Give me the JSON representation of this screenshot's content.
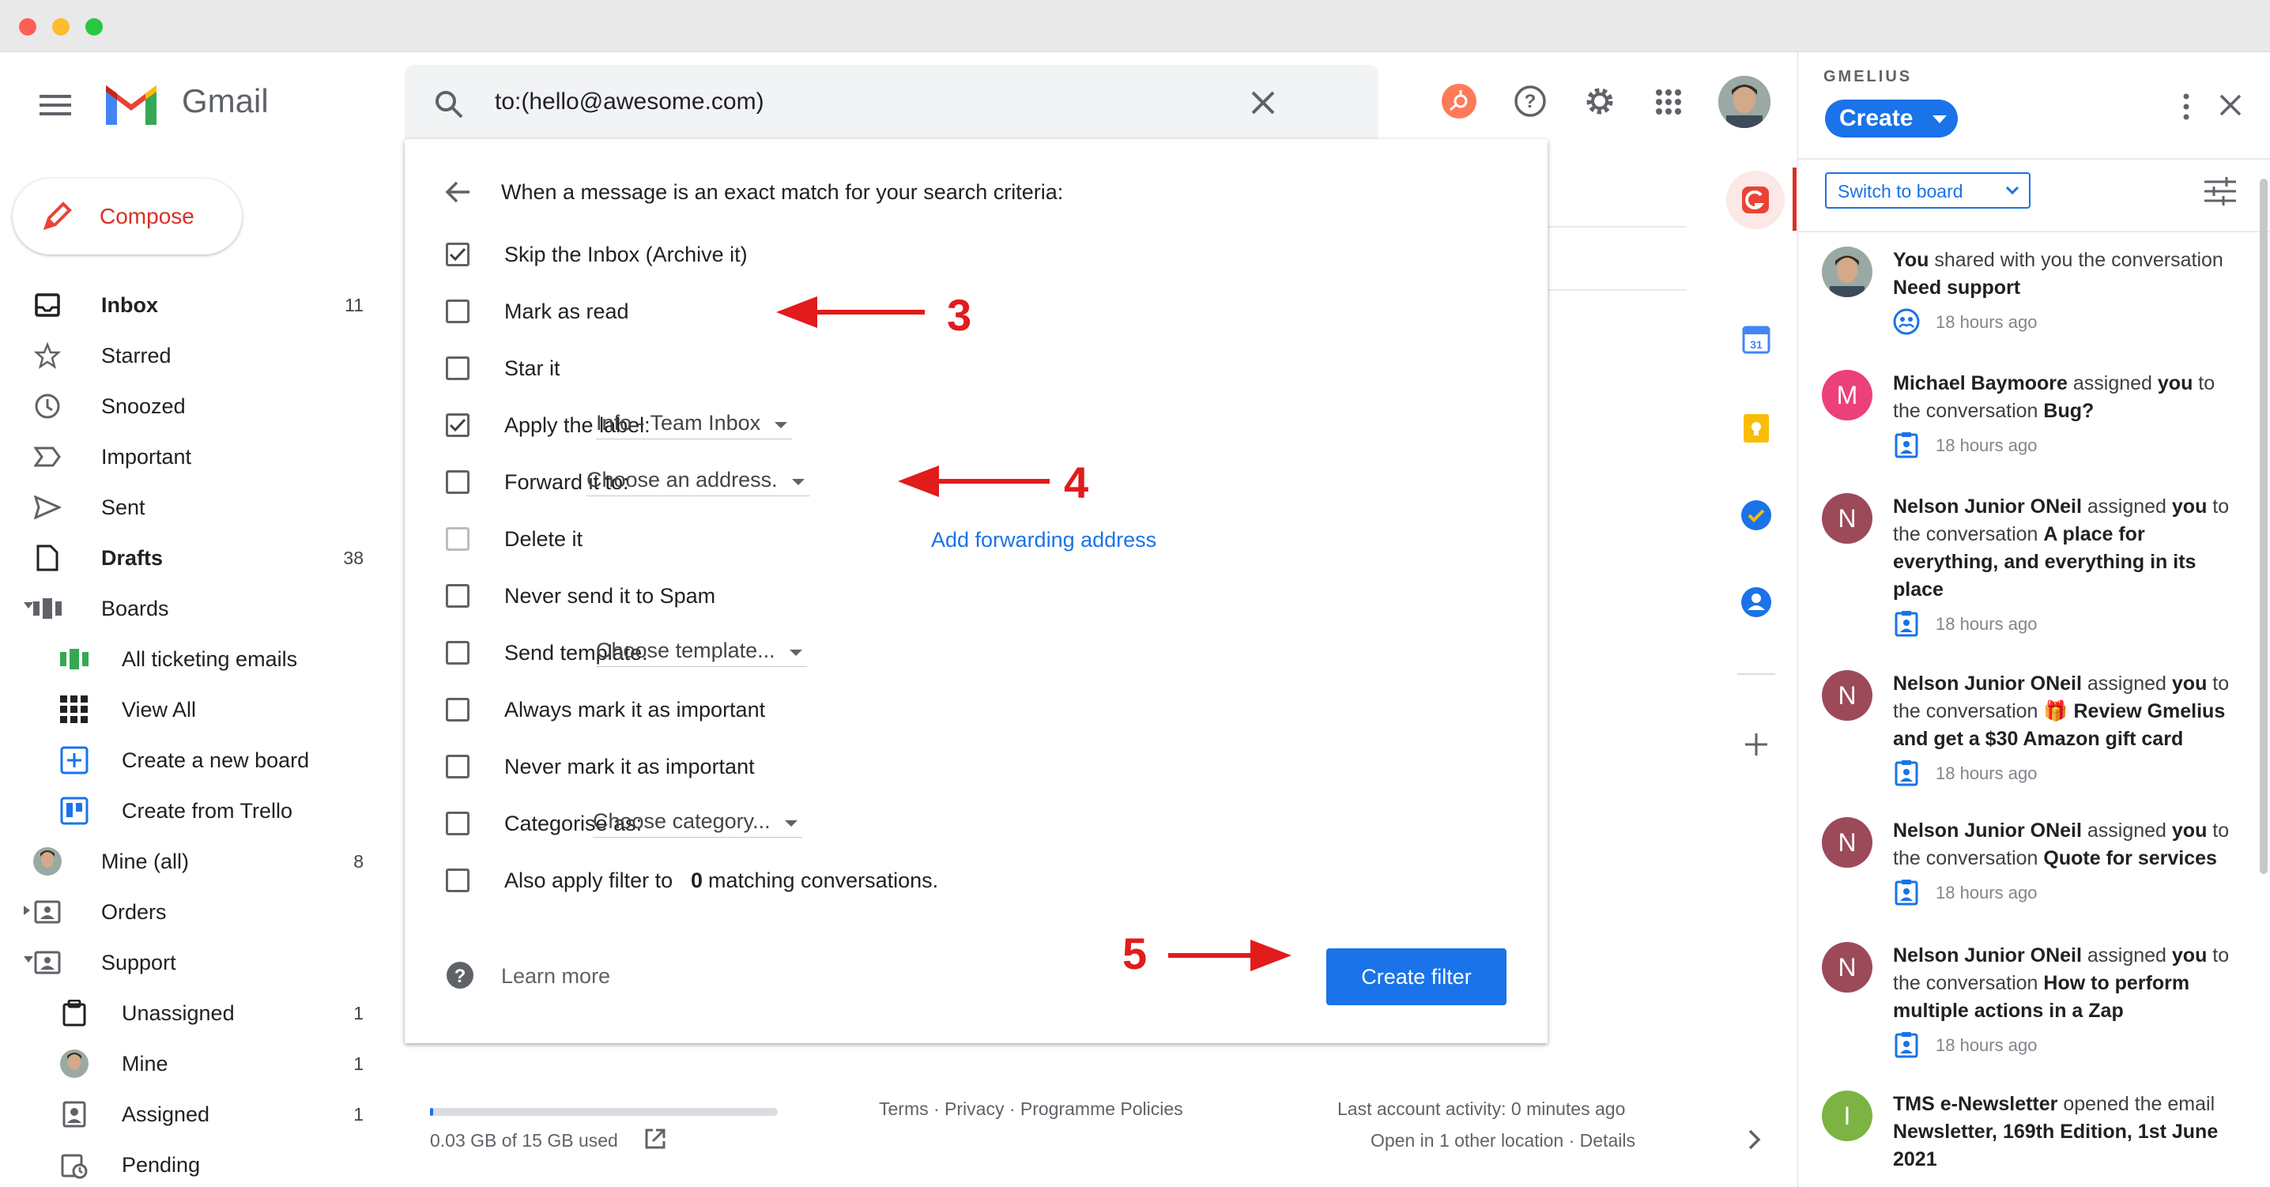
{
  "app": {
    "name": "Gmail",
    "compose": "Compose"
  },
  "search": {
    "query": "to:(hello@awesome.com)"
  },
  "nav": {
    "items": [
      {
        "label": "Inbox",
        "count": "11"
      },
      {
        "label": "Starred",
        "count": ""
      },
      {
        "label": "Snoozed",
        "count": ""
      },
      {
        "label": "Important",
        "count": ""
      },
      {
        "label": "Sent",
        "count": ""
      },
      {
        "label": "Drafts",
        "count": "38"
      },
      {
        "label": "Boards",
        "count": ""
      },
      {
        "label": "All ticketing emails",
        "count": ""
      },
      {
        "label": "View All",
        "count": ""
      },
      {
        "label": "Create a new board",
        "count": ""
      },
      {
        "label": "Create from Trello",
        "count": ""
      },
      {
        "label": "Mine (all)",
        "count": "8"
      },
      {
        "label": "Orders",
        "count": ""
      },
      {
        "label": "Support",
        "count": ""
      },
      {
        "label": "Unassigned",
        "count": "1"
      },
      {
        "label": "Mine",
        "count": "1"
      },
      {
        "label": "Assigned",
        "count": "1"
      },
      {
        "label": "Pending",
        "count": ""
      }
    ]
  },
  "filter": {
    "heading": "When a message is an exact match for your search criteria:",
    "options": [
      {
        "label": "Skip the Inbox (Archive it)",
        "checked": true
      },
      {
        "label": "Mark as read",
        "checked": false
      },
      {
        "label": "Star it",
        "checked": false
      },
      {
        "label": "Apply the label:",
        "checked": true,
        "select": "Info - Team Inbox"
      },
      {
        "label": "Forward it to:",
        "checked": false,
        "select": "Choose an address."
      },
      {
        "label": "Delete it",
        "checked": false
      },
      {
        "label": "Never send it to Spam",
        "checked": false
      },
      {
        "label": "Send template:",
        "checked": false,
        "select": "Choose template..."
      },
      {
        "label": "Always mark it as important",
        "checked": false
      },
      {
        "label": "Never mark it as important",
        "checked": false
      },
      {
        "label": "Categorise as:",
        "checked": false,
        "select": "Choose category..."
      },
      {
        "label": "Also apply filter to",
        "checked": false
      }
    ],
    "match_count": "0",
    "match_suffix": "matching conversations.",
    "add_forwarding": "Add forwarding address",
    "learn_more": "Learn more",
    "create_button": "Create filter"
  },
  "annotations": {
    "a3": "3",
    "a4": "4",
    "a5": "5"
  },
  "footer": {
    "storage": "0.03 GB of 15 GB used",
    "storage_fraction": 0.002,
    "terms": "Terms · Privacy · Programme Policies",
    "activity": "Last account activity: 0 minutes ago",
    "location": "Open in 1 other location · Details"
  },
  "gmelius": {
    "brand": "GMELIUS",
    "create": "Create",
    "switch": "Switch to board",
    "activities": [
      {
        "initial": "",
        "color": "",
        "html_parts": [
          "You",
          " shared with you the conversation ",
          "Need support"
        ],
        "time": "18 hours ago"
      },
      {
        "initial": "M",
        "color": "#ec407a",
        "html_parts": [
          "Michael Baymoore",
          " assigned ",
          "you",
          " to the conversation ",
          "Bug?"
        ],
        "time": "18 hours ago"
      },
      {
        "initial": "N",
        "color": "#9c4a5a",
        "html_parts": [
          "Nelson Junior ONeil",
          " assigned ",
          "you",
          " to the conversation ",
          "A place for everything, and everything in its place"
        ],
        "time": "18 hours ago"
      },
      {
        "initial": "N",
        "color": "#9c4a5a",
        "html_parts": [
          "Nelson Junior ONeil",
          " assigned ",
          "you",
          " to the conversation ",
          "🎁 Review Gmelius and get a $30 Amazon gift card"
        ],
        "time": "18 hours ago"
      },
      {
        "initial": "N",
        "color": "#9c4a5a",
        "html_parts": [
          "Nelson Junior ONeil",
          " assigned ",
          "you",
          " to the conversation ",
          "Quote for services"
        ],
        "time": "18 hours ago"
      },
      {
        "initial": "N",
        "color": "#9c4a5a",
        "html_parts": [
          "Nelson Junior ONeil",
          " assigned ",
          "you",
          " to the conversation ",
          "How to perform multiple actions in a Zap"
        ],
        "time": "18 hours ago"
      },
      {
        "initial": "I",
        "color": "#7cb342",
        "html_parts": [
          "TMS e-Newsletter",
          " opened the email ",
          "Newsletter, 169th Edition, 1st June 2021"
        ],
        "time": ""
      }
    ]
  },
  "colors": {
    "accent": "#1a73e8",
    "annotation": "#e21b1b",
    "gmelius_blue": "#1a73e8"
  }
}
